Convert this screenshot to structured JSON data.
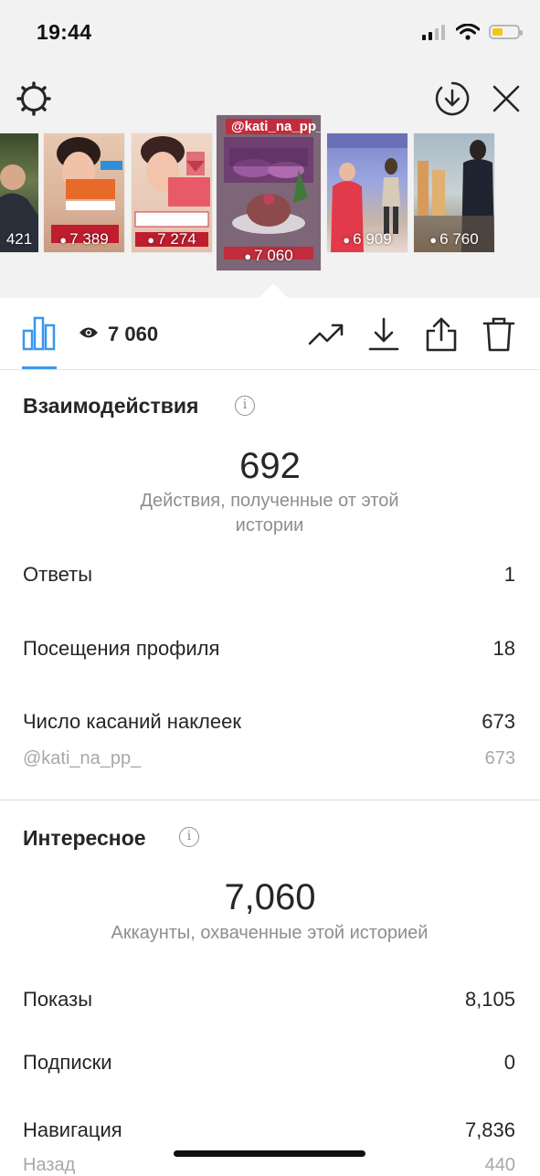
{
  "status_bar": {
    "time": "19:44"
  },
  "stories": [
    {
      "views": "421"
    },
    {
      "views": "7 389"
    },
    {
      "views": "7 274"
    },
    {
      "views": "7 060",
      "handle": "@kati_na_pp_"
    },
    {
      "views": "6 909"
    },
    {
      "views": "6 760"
    }
  ],
  "toolbar": {
    "view_count": "7 060"
  },
  "interactions": {
    "title": "Взаимодействия",
    "total": "692",
    "caption": "Действия, полученные от этой истории",
    "rows": [
      {
        "label": "Ответы",
        "value": "1"
      },
      {
        "label": "Посещения профиля",
        "value": "18"
      },
      {
        "label": "Число касаний наклеек",
        "value": "673"
      }
    ],
    "sub_row": {
      "label": "@kati_na_pp_",
      "value": "673"
    }
  },
  "discovery": {
    "title": "Интересное",
    "total": "7,060",
    "caption": "Аккаунты, охваченные этой историей",
    "rows": [
      {
        "label": "Показы",
        "value": "8,105"
      },
      {
        "label": "Подписки",
        "value": "0"
      },
      {
        "label": "Навигация",
        "value": "7,836"
      }
    ],
    "sub_row": {
      "label": "Назад",
      "value": "440"
    }
  },
  "colors": {
    "accent": "#3897f0",
    "battery": "#f5c518"
  }
}
